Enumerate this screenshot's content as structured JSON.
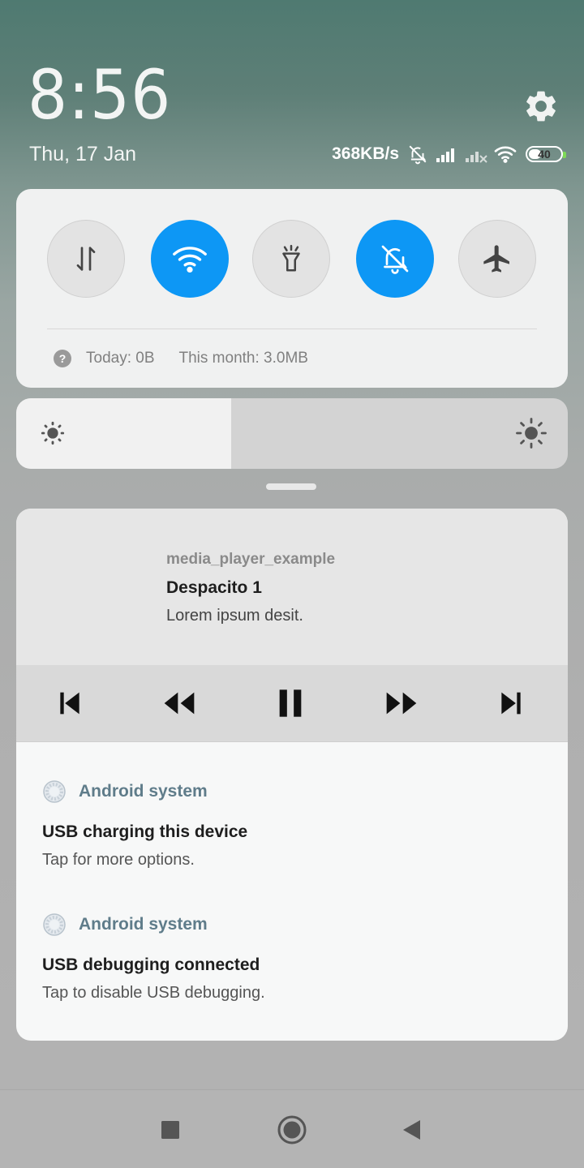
{
  "header": {
    "time": "8:56",
    "date": "Thu, 17 Jan",
    "network_speed": "368KB/s",
    "battery_level": "40",
    "icons": [
      "settings-gear-icon",
      "silent-bell-icon",
      "signal-icon",
      "signal-no-service-icon",
      "wifi-icon",
      "battery-icon"
    ]
  },
  "quick_toggles": {
    "items": [
      {
        "name": "mobile-data",
        "icon": "data-arrows-icon",
        "on": false
      },
      {
        "name": "wifi",
        "icon": "wifi-icon",
        "on": true
      },
      {
        "name": "flashlight",
        "icon": "flashlight-icon",
        "on": false
      },
      {
        "name": "silent",
        "icon": "bell-off-icon",
        "on": true
      },
      {
        "name": "airplane-mode",
        "icon": "airplane-icon",
        "on": false
      }
    ],
    "usage_today": "Today: 0B",
    "usage_month": "This month: 3.0MB",
    "usage_help": "?"
  },
  "brightness": {
    "level": 0.39,
    "low_icon": "sun-small-icon",
    "high_icon": "sun-large-icon"
  },
  "media": {
    "app_name": "media_player_example",
    "title": "Despacito 1",
    "text": "Lorem  ipsum desit.",
    "controls": [
      "skip-previous-icon",
      "rewind-icon",
      "pause-icon",
      "fast-forward-icon",
      "skip-next-icon"
    ]
  },
  "notifications": [
    {
      "app": "Android system",
      "title": "USB charging this device",
      "text": "Tap for more options."
    },
    {
      "app": "Android system",
      "title": "USB debugging connected",
      "text": "Tap to disable USB debugging."
    }
  ],
  "navigation": [
    "recents-square-icon",
    "home-circle-icon",
    "back-triangle-icon"
  ],
  "colors": {
    "accent": "#0d97f5",
    "app_name": "#5f7c8a"
  }
}
